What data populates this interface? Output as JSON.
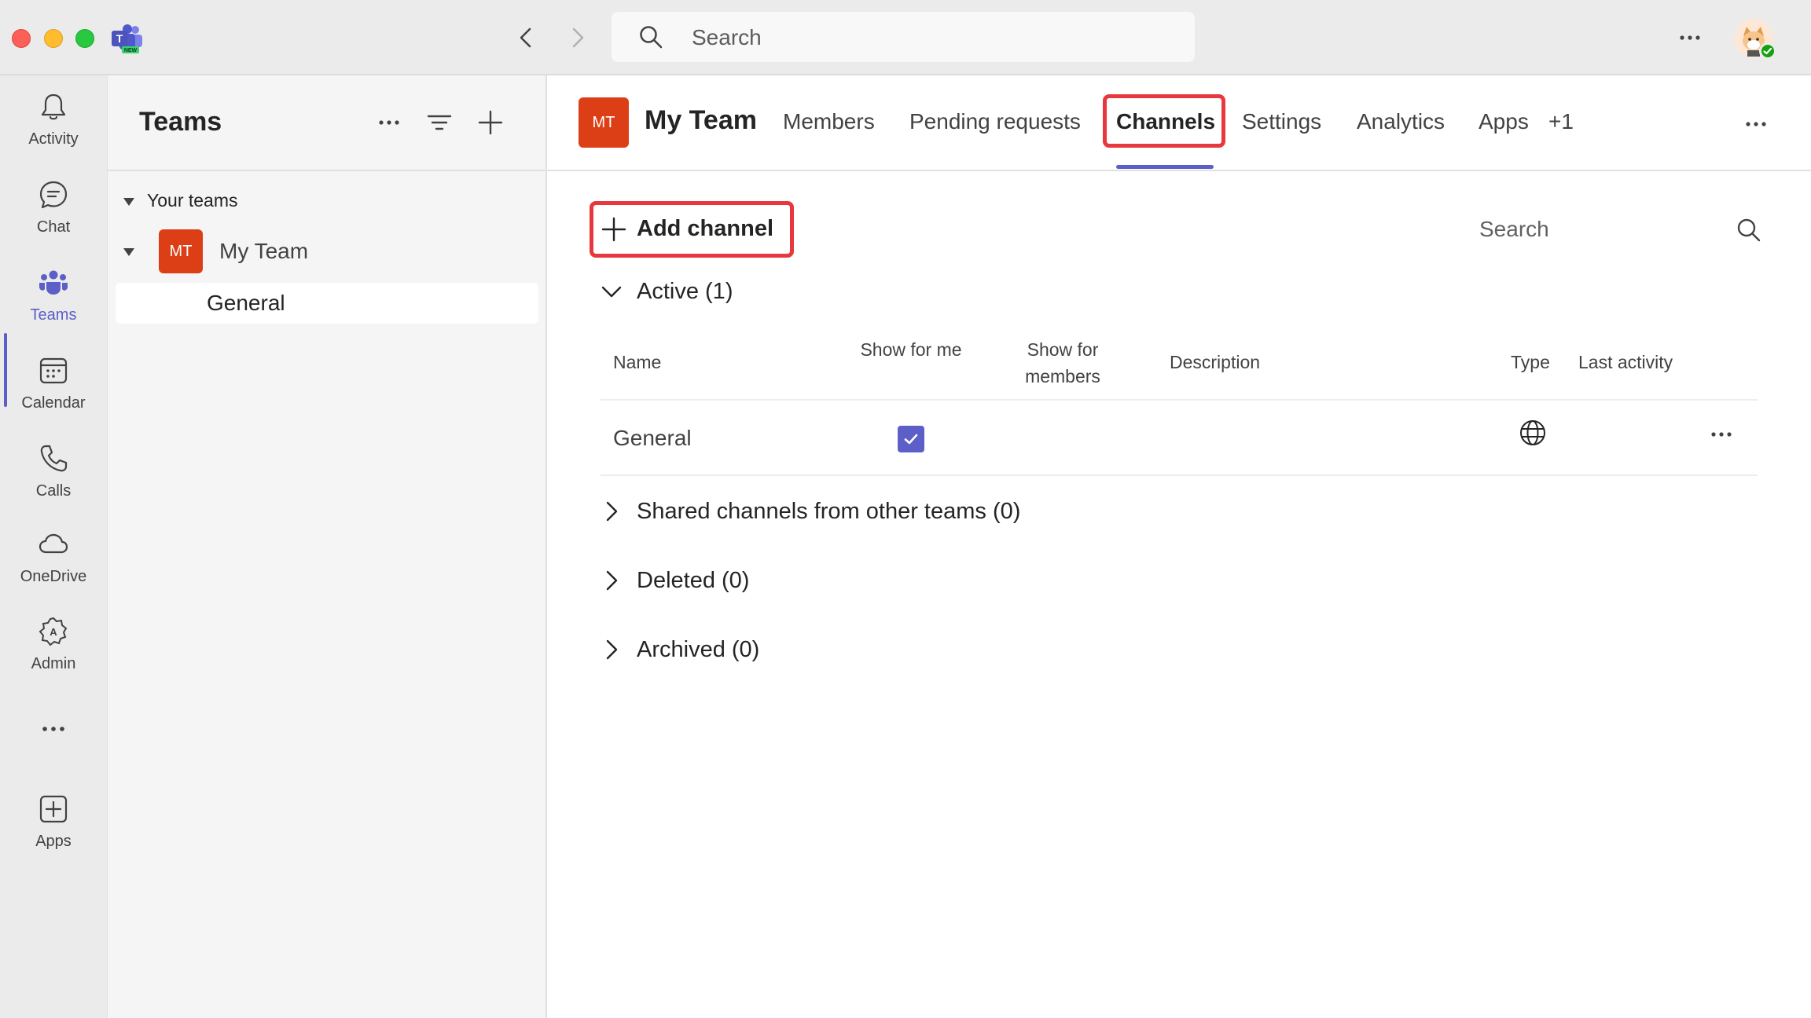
{
  "titlebar": {
    "search_placeholder": "Search",
    "logo_badge": "NEW"
  },
  "rail": {
    "items": [
      {
        "label": "Activity",
        "icon": "bell-icon"
      },
      {
        "label": "Chat",
        "icon": "chat-icon"
      },
      {
        "label": "Teams",
        "icon": "teams-icon",
        "active": true
      },
      {
        "label": "Calendar",
        "icon": "calendar-icon"
      },
      {
        "label": "Calls",
        "icon": "phone-icon"
      },
      {
        "label": "OneDrive",
        "icon": "cloud-icon"
      },
      {
        "label": "Admin",
        "icon": "admin-icon"
      },
      {
        "label": "",
        "icon": "more-icon"
      },
      {
        "label": "Apps",
        "icon": "add-apps-icon"
      }
    ]
  },
  "teams_panel": {
    "title": "Teams",
    "section_label": "Your teams",
    "team": {
      "initials": "MT",
      "name": "My Team"
    },
    "channel": "General"
  },
  "main": {
    "team_initials": "MT",
    "team_name": "My Team",
    "tabs": [
      "Members",
      "Pending requests",
      "Channels",
      "Settings",
      "Analytics",
      "Apps",
      "+1"
    ],
    "active_tab": "Channels",
    "add_channel_label": "Add channel",
    "search_placeholder": "Search",
    "active_section": "Active (1)",
    "columns": {
      "name": "Name",
      "show_for_me": "Show for me",
      "show_for_members": "Show for members",
      "description": "Description",
      "type": "Type",
      "last_activity": "Last activity"
    },
    "rows": [
      {
        "name": "General",
        "show_for_me": true,
        "type_icon": "globe-icon"
      }
    ],
    "collapsed_sections": [
      "Shared channels from other teams (0)",
      "Deleted (0)",
      "Archived (0)"
    ]
  },
  "colors": {
    "accent": "#5b5fc7",
    "team_avatar": "#dc3e15",
    "highlight": "#e8383d"
  }
}
